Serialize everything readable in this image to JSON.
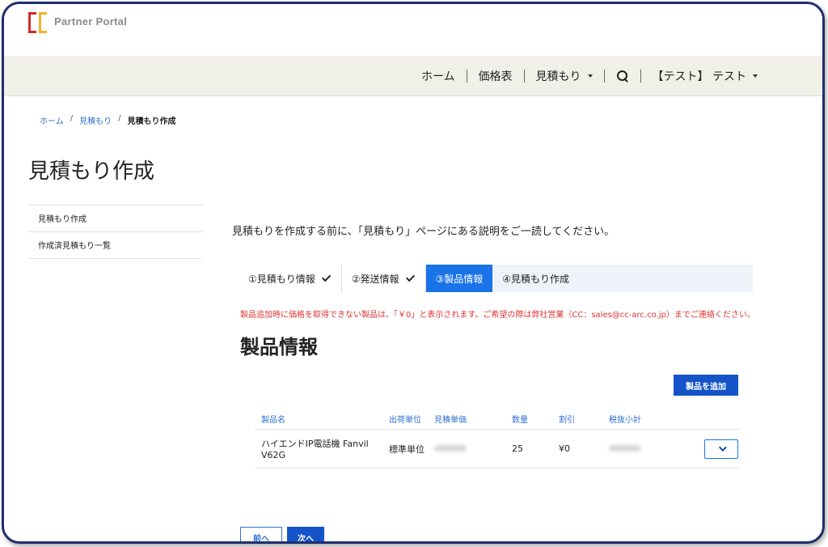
{
  "brand": {
    "name": "Partner Portal"
  },
  "nav": {
    "home": "ホーム",
    "pricelist": "価格表",
    "estimate": "見積もり",
    "user": "【テスト】 テスト"
  },
  "breadcrumb": {
    "home": "ホーム",
    "estimate": "見積もり",
    "current": "見積もり作成"
  },
  "page": {
    "title": "見積もり作成"
  },
  "sidebar": {
    "items": [
      {
        "label": "見積もり作成"
      },
      {
        "label": "作成済見積もり一覧"
      }
    ]
  },
  "main": {
    "intro": "見積もりを作成する前に、「見積もり」ページにある説明をご一読してください。",
    "steps": [
      {
        "label": "①見積もり情報",
        "state": "done"
      },
      {
        "label": "②発送情報",
        "state": "done"
      },
      {
        "label": "③製品情報",
        "state": "active"
      },
      {
        "label": "④見積もり作成",
        "state": "pending"
      }
    ],
    "notice": "製品追加時に価格を取得できない製品は、「￥0」と表示されます。ご希望の際は弊社営業（CC：sales@cc-arc.co.jp）までご連絡ください。",
    "section_title": "製品情報",
    "add_button": "製品を追加",
    "table": {
      "headers": [
        "製品名",
        "出荷単位",
        "見積単価",
        "数量",
        "割引",
        "税抜小計"
      ],
      "rows": [
        {
          "name": "ハイエンドIP電話機 Fanvil V62G",
          "unit": "標準単位",
          "quantity": "25",
          "discount": "¥0"
        }
      ]
    },
    "back_button": "前へ",
    "next_button": "次へ"
  },
  "colors": {
    "primary": "#1454c8",
    "active_step": "#1a73e8",
    "notice": "#e03131",
    "nav_bg": "#f1f0e8",
    "frame": "#1f2f6e"
  }
}
